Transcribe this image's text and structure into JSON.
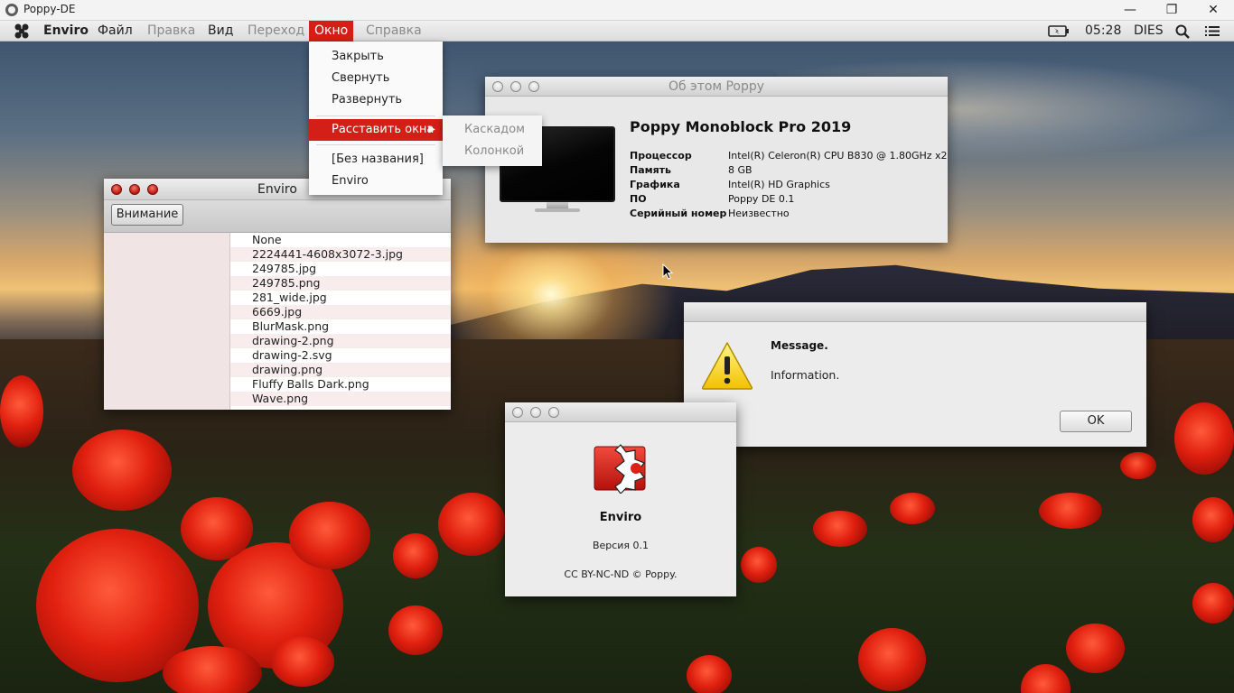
{
  "host_window": {
    "title": "Poppy-DE",
    "buttons": [
      "✕",
      "❐",
      "—"
    ]
  },
  "menubar": {
    "items": [
      {
        "label": "Enviro",
        "state": "bold"
      },
      {
        "label": "Файл",
        "state": "normal"
      },
      {
        "label": "Правка",
        "state": "disabled"
      },
      {
        "label": "Вид",
        "state": "normal"
      },
      {
        "label": "Переход",
        "state": "disabled"
      },
      {
        "label": "Окно",
        "state": "active"
      },
      {
        "label": "Справка",
        "state": "disabled"
      }
    ],
    "tray": {
      "clock": "05:28",
      "user": "DIES",
      "icons": [
        "battery-icon",
        "search-icon",
        "list-icon"
      ]
    }
  },
  "window_menu": {
    "items": [
      "Закрыть",
      "Свернуть",
      "Развернуть"
    ],
    "arrange_label": "Расставить окна",
    "windows": [
      "[Без названия]",
      "Enviro"
    ],
    "submenu": [
      "Каскадом",
      "Колонкой"
    ]
  },
  "enviro_window": {
    "title": "Enviro",
    "attention_button": "Внимание",
    "files": [
      "None",
      "2224441-4608x3072-3.jpg",
      "249785.jpg",
      "249785.png",
      "281_wide.jpg",
      "6669.jpg",
      "BlurMask.png",
      "drawing-2.png",
      "drawing-2.svg",
      "drawing.png",
      "Fluffy Balls Dark.png",
      "Wave.png"
    ]
  },
  "about_window": {
    "title": "Об этом Poppy",
    "heading": "Poppy Monoblock Pro 2019",
    "specs": [
      {
        "key": "Процессор",
        "value": "Intel(R) Celeron(R) CPU B830 @ 1.80GHz x2"
      },
      {
        "key": "Память",
        "value": "8 GB"
      },
      {
        "key": "Графика",
        "value": "Intel(R) HD Graphics"
      },
      {
        "key": "ПО",
        "value": "Poppy DE 0.1"
      },
      {
        "key": "Серийный номер",
        "value": "Неизвестно"
      }
    ]
  },
  "message_dialog": {
    "title": "Message.",
    "text": "Information.",
    "ok_button": "OK",
    "icon": "warning-icon"
  },
  "enviro_about": {
    "name": "Enviro",
    "version": "Версия 0.1",
    "license": "CC BY-NC-ND © Poppy.",
    "icon": "enviro-app-icon"
  },
  "colors": {
    "accent": "#d31f17",
    "menubar_bg": "#e6e6e6",
    "window_bg": "#e8e8e8"
  }
}
